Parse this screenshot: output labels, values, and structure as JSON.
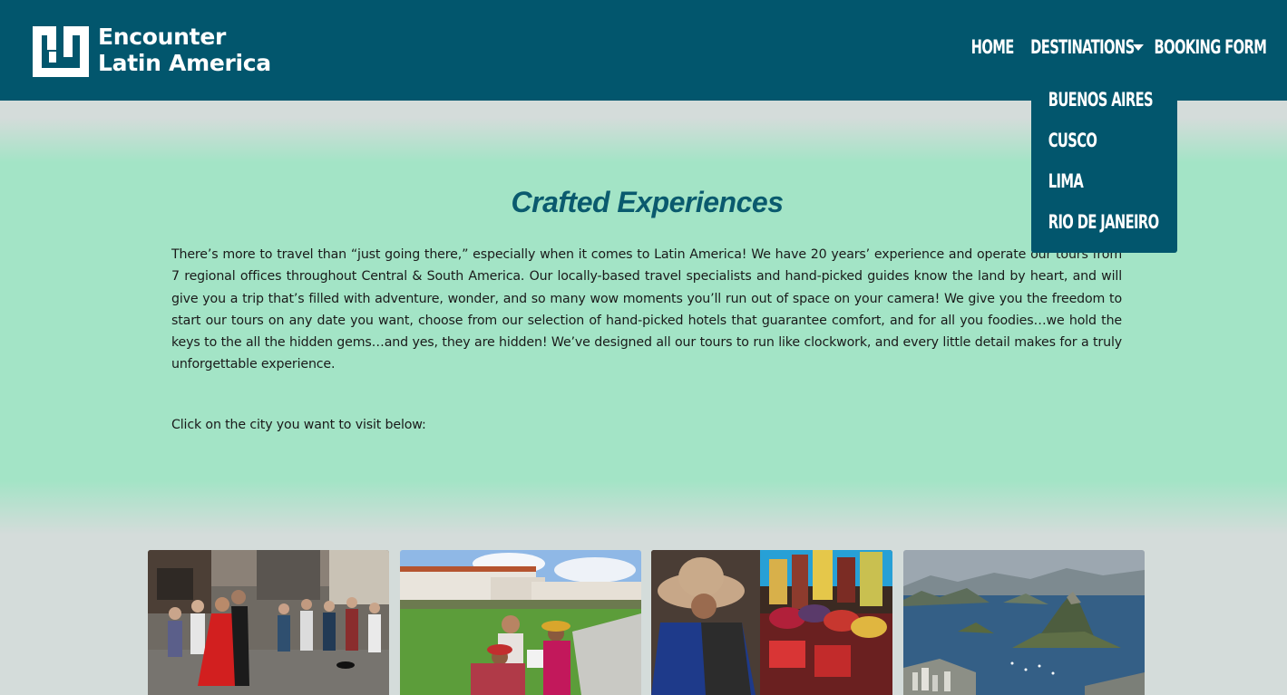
{
  "brand": {
    "line1": "Encounter",
    "line2": "Latin America"
  },
  "nav": {
    "home": "HOME",
    "destinations": "DESTINATIONS",
    "booking": "BOOKING FORM"
  },
  "dropdown": {
    "items": [
      "BUENOS AIRES",
      "CUSCO",
      "LIMA",
      "RIO DE JANEIRO"
    ]
  },
  "main": {
    "title": "Crafted Experiences",
    "intro": "There’s more to travel than “just going there,” especially when it comes to Latin America! We have 20 years’ experience and operate our tours from 7 regional offices throughout Central & South America. Our locally-based travel specialists and hand-picked guides know the land by heart, and will give you a trip that’s filled with adventure, wonder, and so many wow moments you’ll run out of space on your camera! We give you the freedom to start our tours on any date you want, choose from our selection of hand-picked hotels that guarantee comfort, and for all you foodies…we hold the keys to the all the hidden gems…and yes, they are hidden! We’ve designed all our tours to run like clockwork, and every little detail makes for a truly unforgettable experience.",
    "cta": "Click on the city you want to visit below:"
  },
  "cities": [
    "Buenos Aires",
    "Cusco",
    "Lima",
    "Rio de Janeiro"
  ],
  "colors": {
    "header": "#02566d",
    "hero": "#a3e4c6",
    "page": "#d4dcda",
    "title": "#0a5a6e"
  }
}
